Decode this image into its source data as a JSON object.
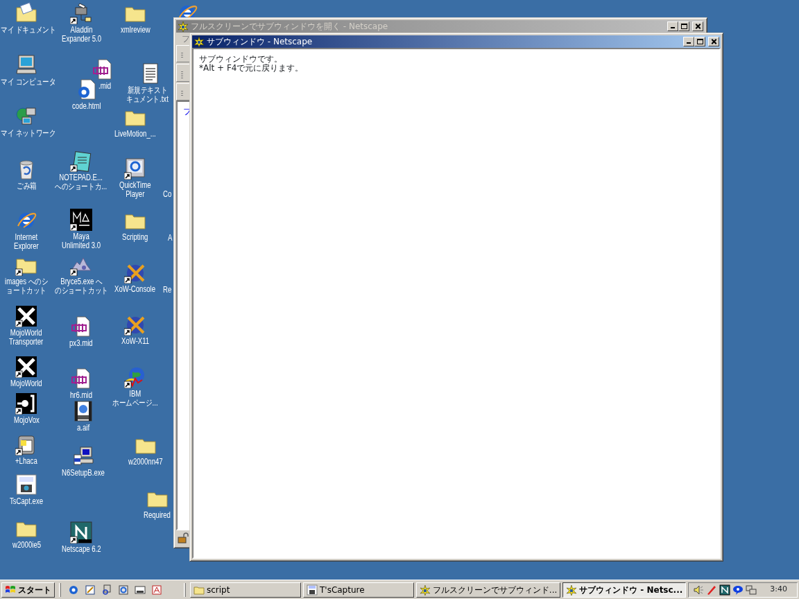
{
  "desktop": {
    "icons": [
      {
        "kind": "mydocs",
        "label": [
          "マイ ドキュメント"
        ],
        "shortcut": false
      },
      {
        "kind": "computer",
        "label": [
          "マイ コンピュータ"
        ],
        "shortcut": false
      },
      {
        "kind": "network",
        "label": [
          "マイ ネットワーク"
        ],
        "shortcut": false
      },
      {
        "kind": "recycle",
        "label": [
          "ごみ箱"
        ],
        "shortcut": false
      },
      {
        "kind": "ie",
        "label": [
          "Internet",
          "Explorer"
        ],
        "shortcut": false
      },
      {
        "kind": "folder",
        "label": [
          "images へのシ",
          "ョートカット"
        ],
        "shortcut": true
      },
      {
        "kind": "mojo",
        "label": [
          "MojoWorld",
          "Transporter"
        ],
        "shortcut": true
      },
      {
        "kind": "mojo",
        "label": [
          "MojoWorld"
        ],
        "shortcut": true
      },
      {
        "kind": "mojovox",
        "label": [
          "MojoVox"
        ],
        "shortcut": true
      },
      {
        "kind": "lhaca",
        "label": [
          "+Lhaca"
        ],
        "shortcut": true
      },
      {
        "kind": "tcap",
        "label": [
          "TsCapt.exe"
        ],
        "shortcut": false
      },
      {
        "kind": "folder",
        "label": [
          "w2000ie5"
        ],
        "shortcut": false
      },
      {
        "kind": "aladdin",
        "label": [
          "Aladdin",
          "Expander 5.0"
        ],
        "shortcut": true
      },
      {
        "kind": "midi",
        "label": [
          ".mid"
        ],
        "shortcut": false
      },
      {
        "kind": "ie-doc",
        "label": [
          "code.html"
        ],
        "shortcut": false
      },
      {
        "kind": "notepad",
        "label": [
          "NOTEPAD.E...",
          "へのショートカ..."
        ],
        "shortcut": true
      },
      {
        "kind": "maya",
        "label": [
          "Maya",
          "Unlimited 3.0"
        ],
        "shortcut": true
      },
      {
        "kind": "bryce",
        "label": [
          "Bryce5.exe へ",
          "のショートカット"
        ],
        "shortcut": true
      },
      {
        "kind": "midi",
        "label": [
          "px3.mid"
        ],
        "shortcut": false
      },
      {
        "kind": "midi",
        "label": [
          "hr6.mid"
        ],
        "shortcut": false
      },
      {
        "kind": "aiff",
        "label": [
          "a.aif"
        ],
        "shortcut": false
      },
      {
        "kind": "setup",
        "label": [
          "N6SetupB.exe"
        ],
        "shortcut": false
      },
      {
        "kind": "netscape",
        "label": [
          "Netscape 6.2"
        ],
        "shortcut": true
      },
      {
        "kind": "folder",
        "label": [
          "xmlreview"
        ],
        "shortcut": false
      },
      {
        "kind": "ie",
        "shortcut": false
      },
      {
        "kind": "text",
        "label": [
          "新規テキスト",
          "キュメント.txt"
        ],
        "shortcut": false
      },
      {
        "kind": "folder",
        "label": [
          "LiveMotion_..."
        ],
        "shortcut": false
      },
      {
        "kind": "quicktime",
        "label": [
          "QuickTime",
          "Player"
        ],
        "shortcut": true
      },
      {
        "kind": "none",
        "label": [
          "Co"
        ]
      },
      {
        "kind": "folder",
        "label": [
          "Scripting"
        ],
        "shortcut": false
      },
      {
        "kind": "none",
        "label": [
          "A"
        ]
      },
      {
        "kind": "xow",
        "label": [
          "XoW-Console"
        ],
        "shortcut": true
      },
      {
        "kind": "none",
        "label": [
          "Re"
        ]
      },
      {
        "kind": "xow",
        "label": [
          "XoW-X11"
        ],
        "shortcut": true
      },
      {
        "kind": "globe",
        "label": [
          "IBM",
          "ホームページ..."
        ],
        "shortcut": true
      },
      {
        "kind": "folder",
        "label": [
          "w2000nn47"
        ],
        "shortcut": false
      },
      {
        "kind": "folder",
        "label": [
          "Required"
        ],
        "shortcut": false
      }
    ]
  },
  "windows": [
    {
      "title": "フルスクリーンでサブウィンドウを開く - Netscape",
      "active": false,
      "menu": "フ",
      "link": "フ"
    },
    {
      "title": "サブウィンドウ - Netscape",
      "active": true,
      "content": [
        "サブウィンドウです。",
        "*Alt + F4で元に戻ります。"
      ]
    }
  ],
  "taskbar": {
    "start": "スタート",
    "tasks": [
      {
        "label": "script",
        "kind": "folder",
        "selected": false
      },
      {
        "label": "T'sCapture",
        "kind": "tcap",
        "selected": false
      },
      {
        "label": "フルスクリーンでサブウィンド...",
        "kind": "netscape-star",
        "selected": false
      },
      {
        "label": "サブウィンドウ - Netsc...",
        "kind": "netscape-star",
        "selected": true
      }
    ],
    "clock": "3:40"
  }
}
